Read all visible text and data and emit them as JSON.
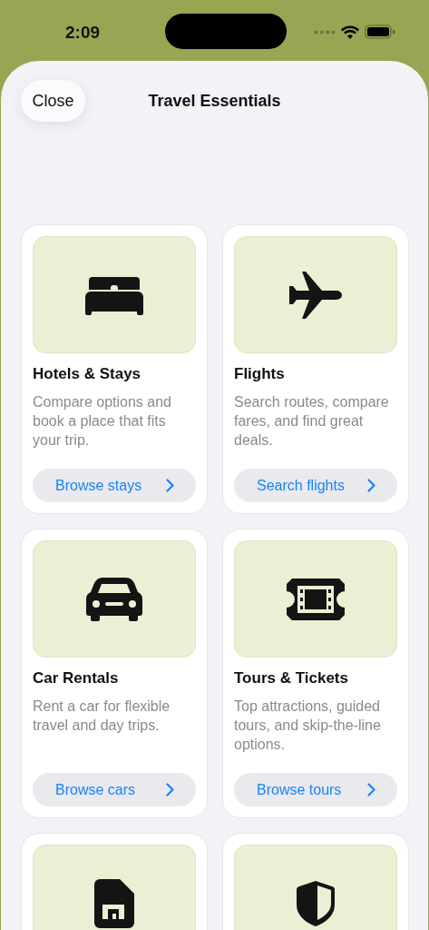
{
  "status_bar": {
    "time": "2:09"
  },
  "header": {
    "close_button": "Close",
    "title": "Travel Essentials"
  },
  "cards": [
    {
      "kind": "stays",
      "title": "Hotels & Stays",
      "description": "Compare options and book a place that fits your trip.",
      "action": "Browse stays"
    },
    {
      "kind": "flights",
      "title": "Flights",
      "description": "Search routes, compare fares, and find great deals.",
      "action": "Search flights"
    },
    {
      "kind": "cars",
      "title": "Car Rentals",
      "description": "Rent a car for flexible travel and day trips.",
      "action": "Browse cars"
    },
    {
      "kind": "tours",
      "title": "Tours & Tickets",
      "description": "Top attractions, guided tours, and skip-the-line options.",
      "action": "Browse tours"
    },
    {
      "kind": "sim"
    },
    {
      "kind": "protection"
    }
  ]
}
